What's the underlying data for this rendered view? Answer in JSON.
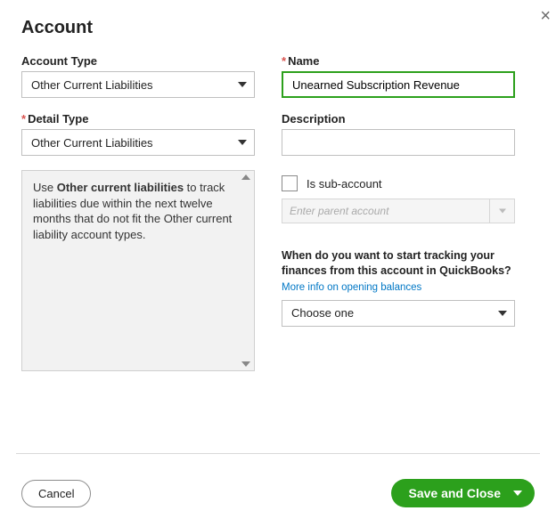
{
  "modal": {
    "title": "Account",
    "close_icon": "×"
  },
  "left": {
    "account_type_label": "Account Type",
    "account_type_value": "Other Current Liabilities",
    "detail_type_label": "Detail Type",
    "detail_type_value": "Other Current Liabilities",
    "info_prefix": "Use ",
    "info_bold": "Other current liabilities",
    "info_rest": " to track liabilities due within the next twelve months that do not fit the Other current liability account types."
  },
  "right": {
    "name_label": "Name",
    "name_value": "Unearned Subscription Revenue",
    "description_label": "Description",
    "description_value": "",
    "sub_checkbox_label": "Is sub-account",
    "parent_placeholder": "Enter parent account",
    "tracking_question": "When do you want to start tracking your finances from this account in QuickBooks?",
    "more_info_link": "More info on opening balances",
    "tracking_select_value": "Choose one"
  },
  "footer": {
    "cancel": "Cancel",
    "save": "Save and Close"
  }
}
